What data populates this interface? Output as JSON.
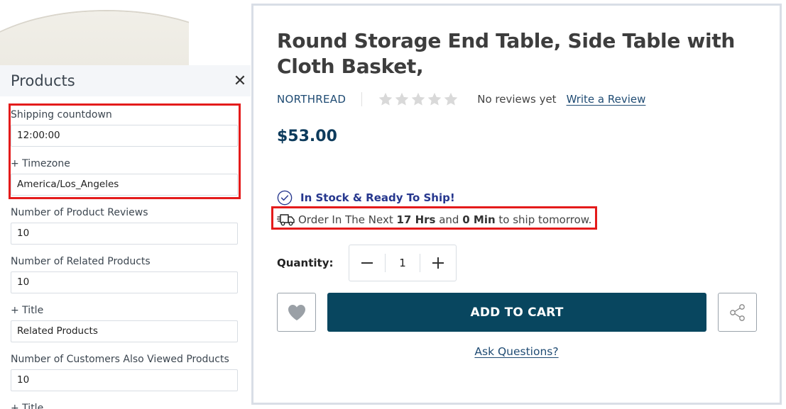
{
  "settings_panel": {
    "title": "Products",
    "close_icon": "close-icon",
    "fields": [
      {
        "label": "Shipping countdown",
        "value": "12:00:00"
      },
      {
        "label": "+ Timezone",
        "value": "America/Los_Angeles"
      },
      {
        "label": "Number of Product Reviews",
        "value": "10"
      },
      {
        "label": "Number of Related Products",
        "value": "10"
      },
      {
        "label": "+ Title",
        "value": "Related Products"
      },
      {
        "label": "Number of Customers Also Viewed Products",
        "value": "10"
      },
      {
        "label": "+ Title",
        "value": ""
      }
    ]
  },
  "product": {
    "title": "Round Storage End Table, Side Table with Cloth Basket,",
    "brand": "NORTHREAD",
    "rating_stars": 0,
    "reviews_text": "No reviews yet",
    "write_review": "Write a Review",
    "price": "$53.00",
    "stock_text": "In Stock & Ready To Ship!",
    "ship_prefix": "Order In The Next ",
    "ship_hours": "17 Hrs",
    "ship_and": " and ",
    "ship_min": "0 Min",
    "ship_suffix": " to ship tomorrow.",
    "quantity_label": "Quantity:",
    "quantity_value": "1",
    "add_to_cart": "ADD TO CART",
    "ask_questions": "Ask Questions?"
  },
  "colors": {
    "highlight": "#e41b1b",
    "brand_blue": "#1f4b73",
    "cart_button": "#08465f",
    "stock_blue": "#26378e",
    "star_gray": "#d9d9d9"
  }
}
